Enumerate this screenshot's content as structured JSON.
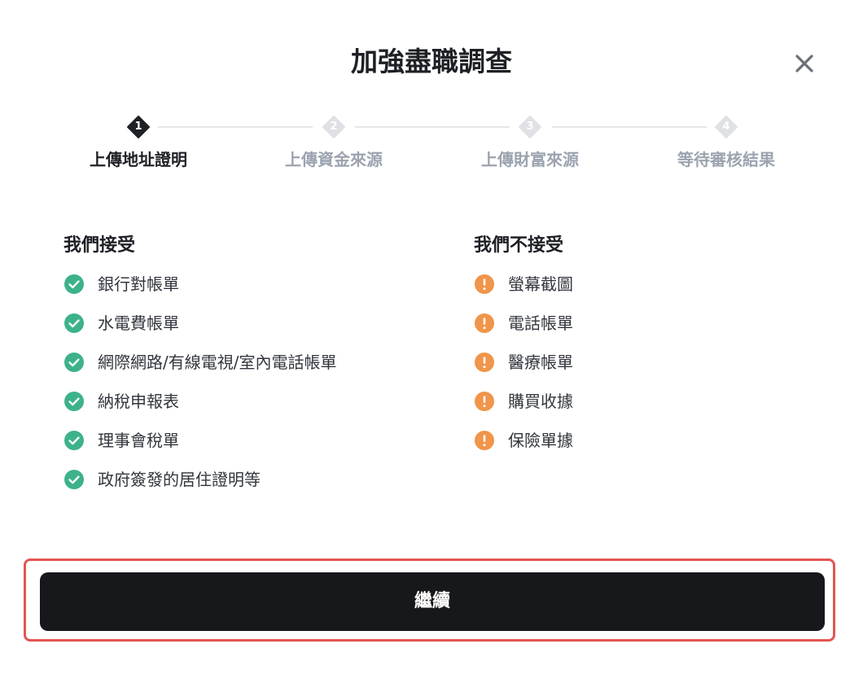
{
  "modal": {
    "title": "加強盡職調查",
    "close_icon": "close-icon"
  },
  "stepper": {
    "steps": [
      {
        "number": "1",
        "label": "上傳地址證明",
        "state": "active"
      },
      {
        "number": "2",
        "label": "上傳資金來源",
        "state": "inactive"
      },
      {
        "number": "3",
        "label": "上傳財富來源",
        "state": "inactive"
      },
      {
        "number": "4",
        "label": "等待審核結果",
        "state": "inactive"
      }
    ]
  },
  "accepted": {
    "title": "我們接受",
    "icon": "check-circle-icon",
    "color": "#3db28a",
    "items": [
      "銀行對帳單",
      "水電費帳單",
      "網際網路/有線電視/室內電話帳單",
      "納稅申報表",
      "理事會稅單",
      "政府簽發的居住證明等"
    ]
  },
  "rejected": {
    "title": "我們不接受",
    "icon": "exclamation-circle-icon",
    "color": "#f0954a",
    "items": [
      "螢幕截圖",
      "電話帳單",
      "醫療帳單",
      "購買收據",
      "保險單據"
    ]
  },
  "footer": {
    "continue_label": "繼續"
  },
  "colors": {
    "primary_button": "#17181c",
    "highlight_border": "#e25555",
    "step_active": "#1e2026",
    "step_inactive": "#d9dbe0"
  }
}
